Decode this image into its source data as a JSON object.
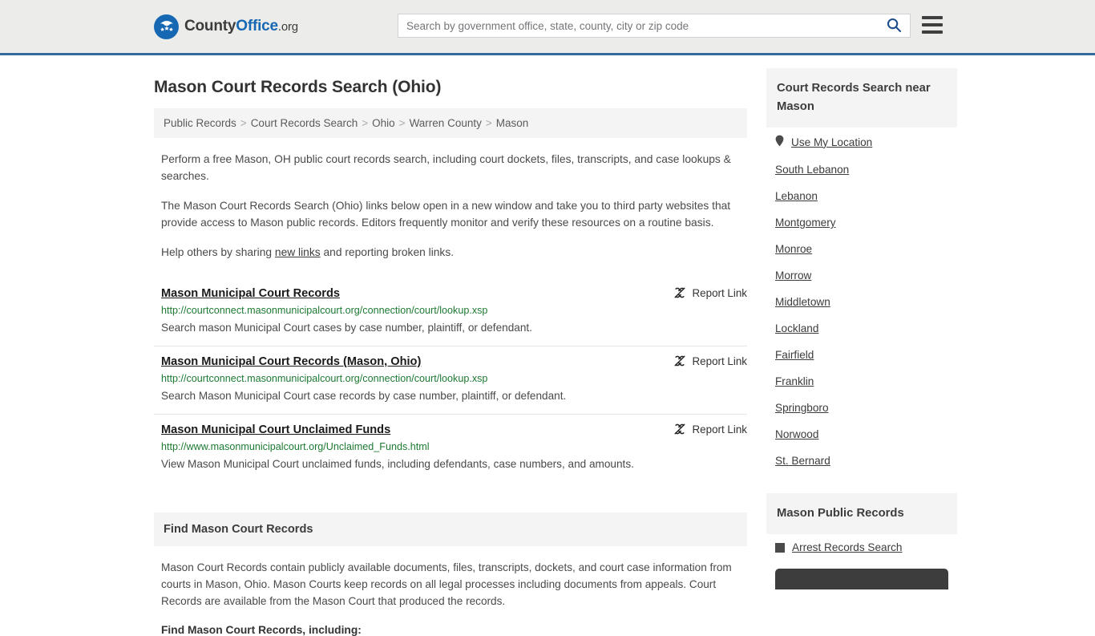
{
  "header": {
    "logo": {
      "icon": "eagle-stars-logo",
      "part1": "County",
      "part2": "Office",
      "part3": ".org"
    },
    "search": {
      "placeholder": "Search by government office, state, county, city or zip code",
      "value": "",
      "icon": "search-icon"
    },
    "menu_icon": "hamburger-menu-icon"
  },
  "page_title": "Mason Court Records Search (Ohio)",
  "breadcrumb": {
    "separator": ">",
    "items": [
      {
        "label": "Public Records"
      },
      {
        "label": "Court Records Search"
      },
      {
        "label": "Ohio"
      },
      {
        "label": "Warren County"
      },
      {
        "label": "Mason"
      }
    ]
  },
  "intro": {
    "p1": "Perform a free Mason, OH public court records search, including court dockets, files, transcripts, and case lookups & searches.",
    "p2": "The Mason Court Records Search (Ohio) links below open in a new window and take you to third party websites that provide access to Mason public records. Editors frequently monitor and verify these resources on a routine basis.",
    "p3_before": "Help others by sharing ",
    "p3_link": "new links",
    "p3_after": " and reporting broken links."
  },
  "report_label": "Report Link",
  "report_icon": "broken-link-icon",
  "listings": [
    {
      "title": "Mason Municipal Court Records",
      "url": "http://courtconnect.masonmunicipalcourt.org/connection/court/lookup.xsp",
      "description": "Search mason Municipal Court cases by case number, plaintiff, or defendant."
    },
    {
      "title": "Mason Municipal Court Records (Mason, Ohio)",
      "url": "http://courtconnect.masonmunicipalcourt.org/connection/court/lookup.xsp",
      "description": "Search Mason Municipal Court case records by case number, plaintiff, or defendant."
    },
    {
      "title": "Mason Municipal Court Unclaimed Funds",
      "url": "http://www.masonmunicipalcourt.org/Unclaimed_Funds.html",
      "description": "View Mason Municipal Court unclaimed funds, including defendants, case numbers, and amounts."
    }
  ],
  "find_section": {
    "heading": "Find Mason Court Records",
    "body": "Mason Court Records contain publicly available documents, files, transcripts, dockets, and court case information from courts in Mason, Ohio. Mason Courts keep records on all legal processes including documents from appeals. Court Records are available from the Mason Court that produced the records.",
    "subheading": "Find Mason Court Records, including:"
  },
  "sidebar": {
    "nearby": {
      "heading": "Court Records Search near Mason",
      "use_location": {
        "label": "Use My Location",
        "icon": "map-pin-icon"
      },
      "cities": [
        {
          "label": "South Lebanon"
        },
        {
          "label": "Lebanon"
        },
        {
          "label": "Montgomery"
        },
        {
          "label": "Monroe"
        },
        {
          "label": "Morrow"
        },
        {
          "label": "Middletown"
        },
        {
          "label": "Lockland"
        },
        {
          "label": "Fairfield"
        },
        {
          "label": "Franklin"
        },
        {
          "label": "Springboro"
        },
        {
          "label": "Norwood"
        },
        {
          "label": "St. Bernard"
        }
      ]
    },
    "public_records": {
      "heading": "Mason Public Records",
      "items": [
        {
          "label": "Arrest Records Search",
          "icon": "square-bullet-icon"
        }
      ]
    }
  },
  "colors": {
    "header_bg": "#ececeb",
    "header_border": "#36699e",
    "brand_blue": "#1768b3",
    "url_green": "#1d7a33",
    "panel_gray": "#f4f4f4"
  }
}
